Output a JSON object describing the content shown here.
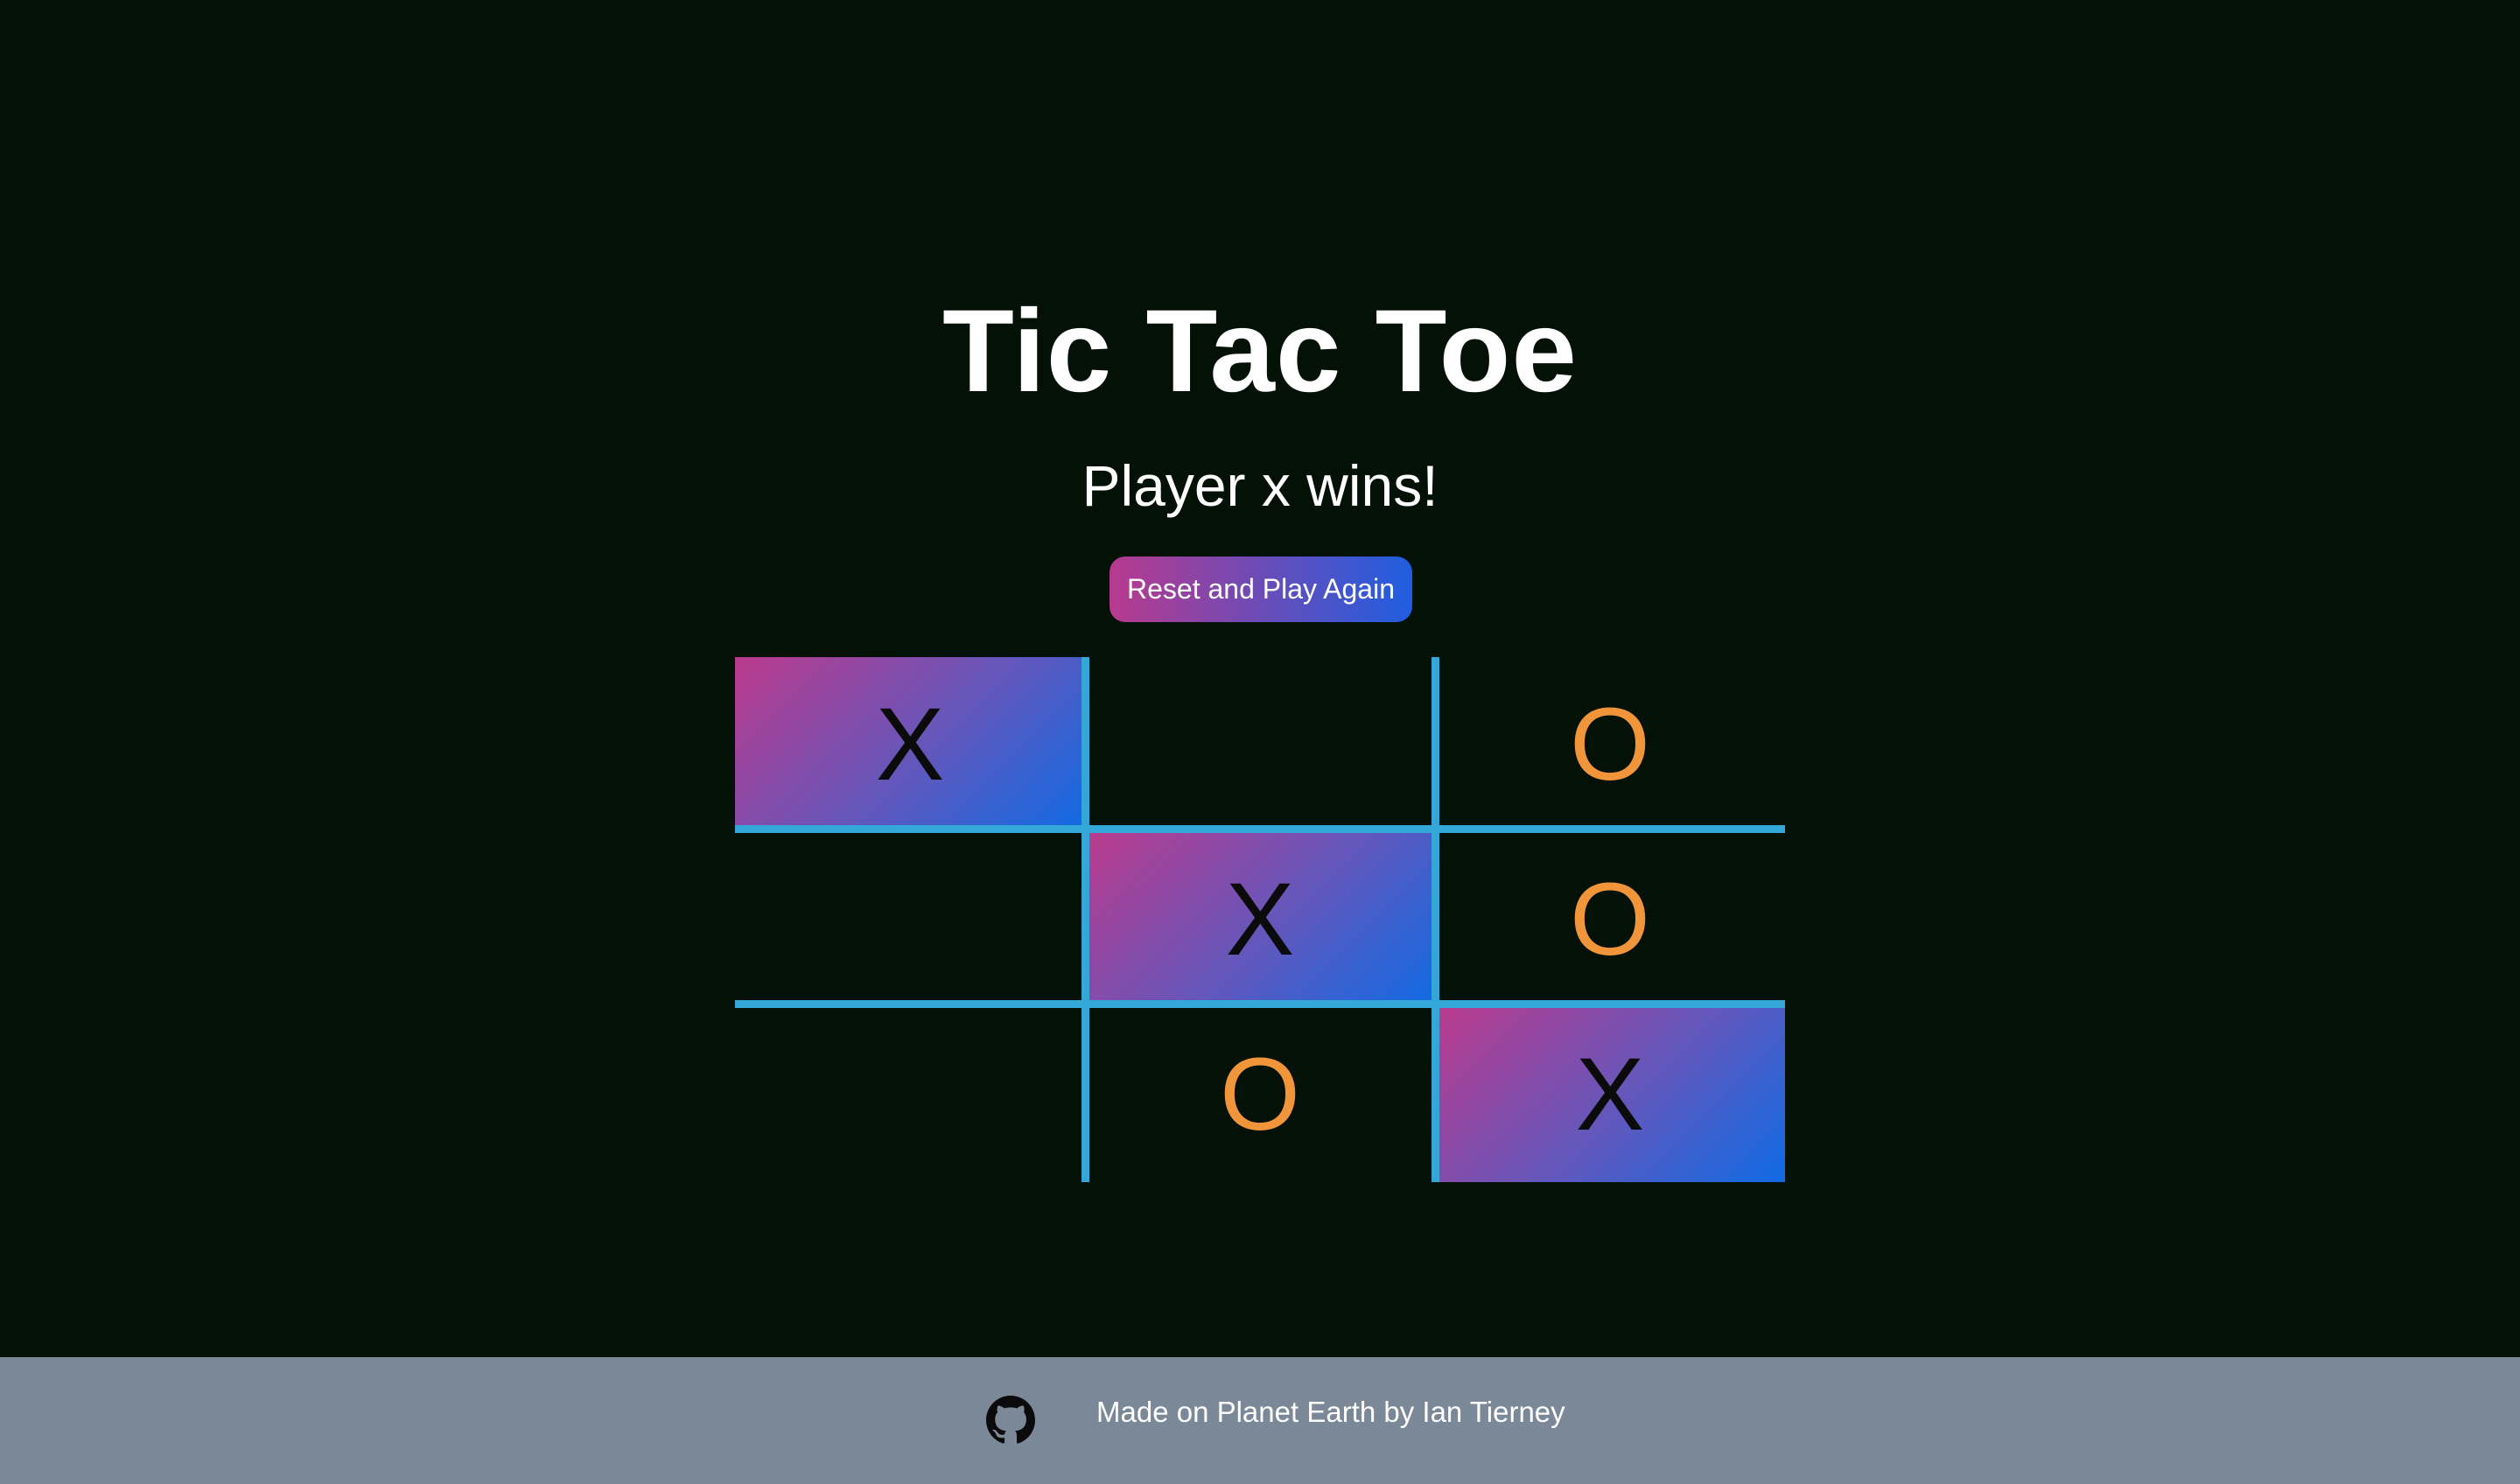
{
  "header": {
    "title": "Tic Tac Toe",
    "status": "Player x wins!",
    "reset_label": "Reset and Play Again"
  },
  "board": {
    "cells": [
      "X",
      "",
      "O",
      "",
      "X",
      "O",
      "",
      "O",
      "X"
    ],
    "winning_cells": [
      0,
      4,
      8
    ],
    "winner": "x"
  },
  "footer": {
    "text": "Made on Planet Earth by Ian Tierney",
    "icon": "github-icon"
  },
  "colors": {
    "background": "#031107",
    "grid_line": "#34a6d8",
    "o_mark": "#f0953a",
    "x_mark": "#0b0b0b",
    "win_gradient_start": "#bb3a8c",
    "win_gradient_end": "#0f6be5",
    "footer_bg": "#7a8898"
  }
}
